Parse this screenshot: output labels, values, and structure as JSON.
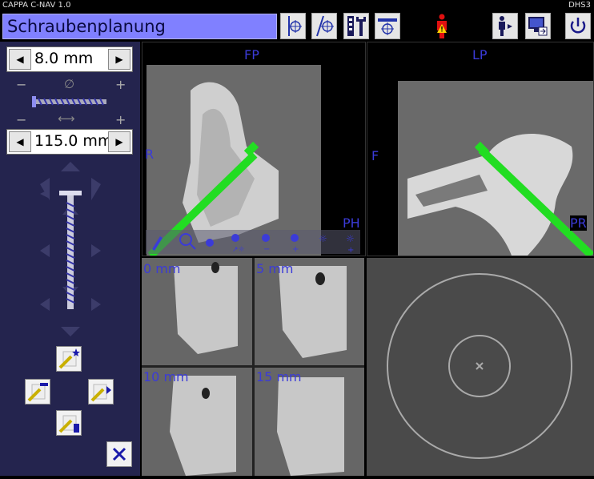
{
  "app": {
    "title": "CAPPA C-NAV 1.0",
    "code": "DHS3"
  },
  "page": {
    "title": "Schraubenplanung"
  },
  "toolbar": {
    "icons": [
      "axis-target-icon",
      "tilted-axis-target-icon",
      "ruler-wrench-icon",
      "slice-target-icon",
      "warning-person-icon",
      "patient-arrow-icon",
      "monitor-export-icon",
      "power-icon"
    ]
  },
  "screw": {
    "diameter": "8.0 mm",
    "length": "115.0 mm",
    "diameter_symbol": "∅",
    "length_symbol": "⟷",
    "minus": "−",
    "plus": "+"
  },
  "views": {
    "fp": {
      "label": "FP",
      "left": "R",
      "corner": "PH"
    },
    "lp": {
      "label": "LP",
      "left": "F",
      "corner": "PR"
    }
  },
  "slices": [
    {
      "label": "0 mm"
    },
    {
      "label": "5 mm"
    },
    {
      "label": "10 mm"
    },
    {
      "label": "15 mm"
    }
  ],
  "colors": {
    "accent": "#8080ff",
    "panel": "#24244e",
    "guide": "#22dd22",
    "label": "#3b3bd8"
  }
}
